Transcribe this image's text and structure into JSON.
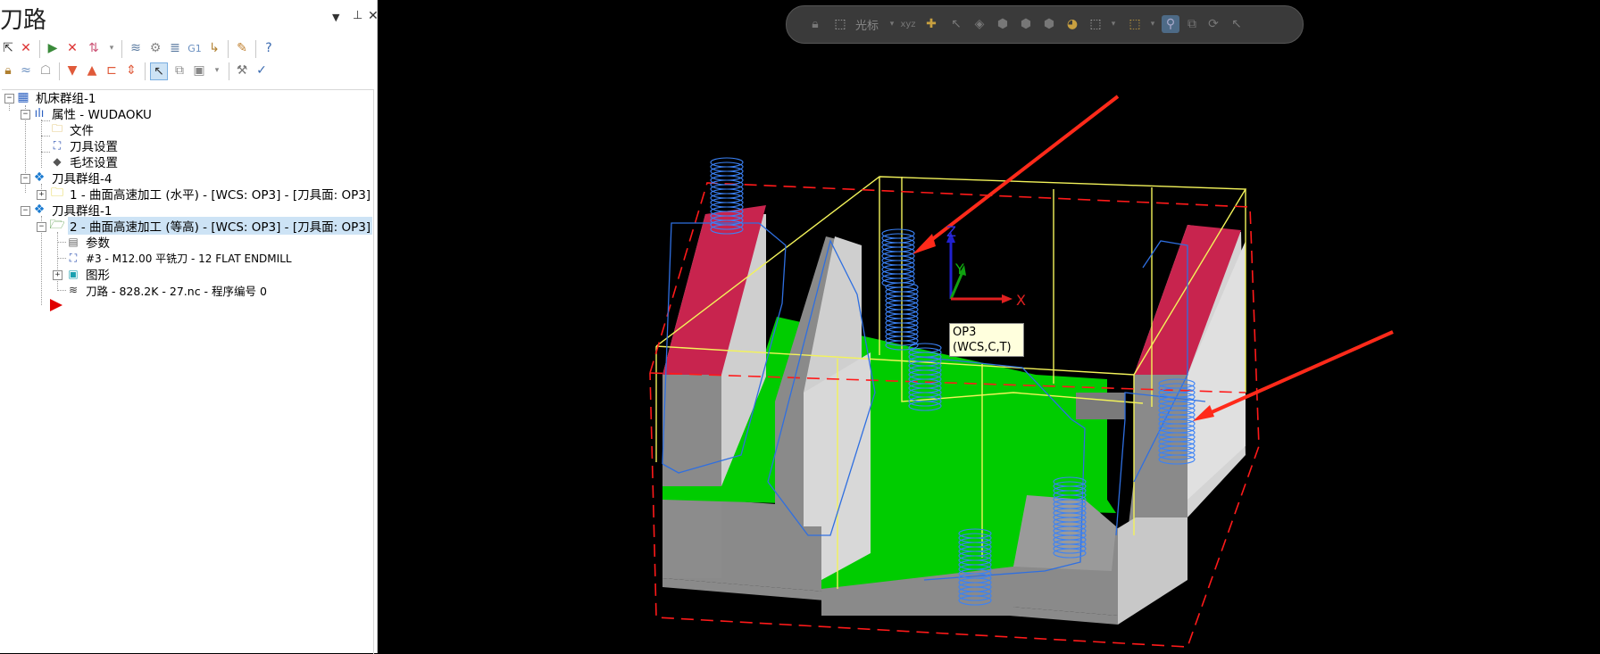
{
  "panel": {
    "title": "刀路",
    "dropdown_glyph": "▼",
    "pin_glyph": "⊥",
    "close_glyph": "✕"
  },
  "toolbar_row1": [
    "select-all-icon",
    "deselect-icon",
    "regen-icon",
    "regen-dirty-icon",
    "sort-icon",
    "toolpath-display-icon",
    "toolpath-lock-icon",
    "toolpath-post-icon",
    "g1-icon",
    "move-icon",
    "wrench-icon",
    "help-icon"
  ],
  "toolbar_row2": [
    "lock-icon",
    "wave-icon",
    "ghost-icon",
    "move-down-icon",
    "move-up-icon",
    "insert-icon",
    "expand-icon",
    "select-arrow-icon",
    "copy-icon",
    "view-options-icon",
    "wizard-icon",
    "tool-check-icon"
  ],
  "tree": {
    "machine_group": "机床群组-1",
    "properties": "属性 - WUDAOKU",
    "files": "文件",
    "tool_settings": "刀具设置",
    "stock_settings": "毛坯设置",
    "toolgroup4": "刀具群组-4",
    "op1": "1 - 曲面高速加工 (水平) - [WCS: OP3] - [刀具面: OP3]",
    "toolgroup1": "刀具群组-1",
    "op2": "2 - 曲面高速加工 (等高) - [WCS: OP3] - [刀具面: OP3]",
    "params": "参数",
    "tool": "#3 - M12.00 平铣刀 - 12 FLAT ENDMILL",
    "geometry": "图形",
    "toolpath": "刀路 - 828.2K - 27.nc - 程序编号 0"
  },
  "viewport_toolbar": {
    "cursor_label": "光标",
    "icons": [
      "lock-icon",
      "cursor-icon",
      "xyz-icon",
      "point-add-icon",
      "select-icon",
      "cube1-icon",
      "cube2-icon",
      "cube3-icon",
      "cube4-icon",
      "shade-icon",
      "select-mode-icon",
      "box-select-icon",
      "zoom-icon",
      "zoom-window-icon",
      "rotate-icon",
      "pan-icon"
    ]
  },
  "axes": {
    "x": "X",
    "y": "Y",
    "z": "Z"
  },
  "tooltip": {
    "line1": "OP3",
    "line2": "(WCS,C,T)"
  },
  "colors": {
    "toolpath_blue": "#2f6fe0",
    "stock_yellow": "#f3f35a",
    "boundary_red": "#ff1a1a",
    "floor_green": "#00cc00",
    "wall_top_magenta": "#c8244e",
    "arrow_red": "#ff2a1a"
  }
}
